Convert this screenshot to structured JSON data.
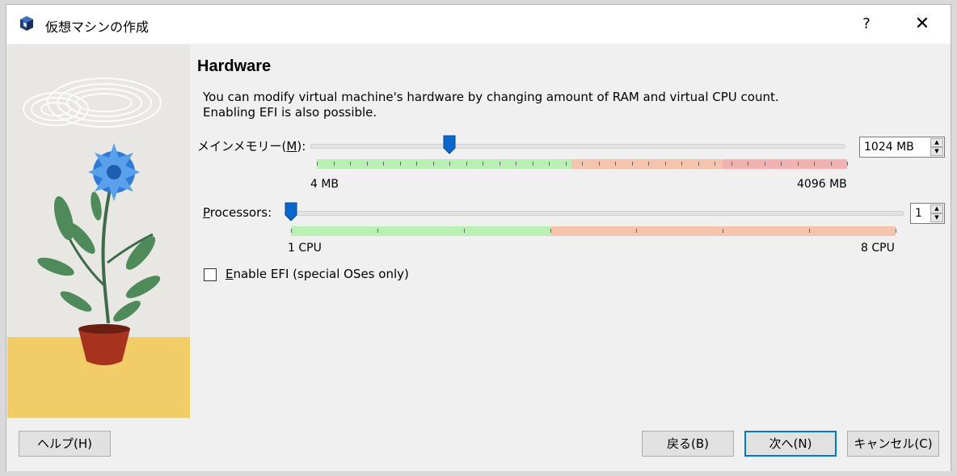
{
  "window": {
    "title": "仮想マシンの作成",
    "help_glyph": "?",
    "close_glyph": "✕"
  },
  "page": {
    "heading": "Hardware",
    "description_line1": "You can modify virtual machine's hardware by changing amount of RAM and virtual CPU count.",
    "description_line2": "Enabling EFI is also possible."
  },
  "memory": {
    "label": "メインメモリー(",
    "label_mnemonic": "M",
    "label_tail": "):",
    "min_label": "4 MB",
    "max_label": "4096 MB",
    "value": "1024 MB",
    "value_mb": 1024,
    "min_mb": 4,
    "max_mb": 4096
  },
  "processors": {
    "label_mnemonic": "P",
    "label_tail": "rocessors:",
    "min_label": "1 CPU",
    "max_label": "8 CPU",
    "value": "1",
    "value_num": 1,
    "min": 1,
    "max": 8
  },
  "efi": {
    "label_mnemonic": "E",
    "label_tail": "nable EFI (special OSes only)",
    "checked": false
  },
  "buttons": {
    "help": "ヘルプ(H)",
    "back": "戻る(B)",
    "next": "次へ(N)",
    "cancel": "キャンセル(C)"
  },
  "colors": {
    "scale_green": "#b9f0b4",
    "scale_orange": "#f6c3ac",
    "scale_red": "#f3b2b2",
    "thumb_blue": "#0a66cc",
    "default_button_border": "#0078d7"
  },
  "icons": {
    "app": "virtualbox-cube-icon",
    "spin_up": "up-arrow-icon",
    "spin_down": "down-arrow-icon"
  }
}
